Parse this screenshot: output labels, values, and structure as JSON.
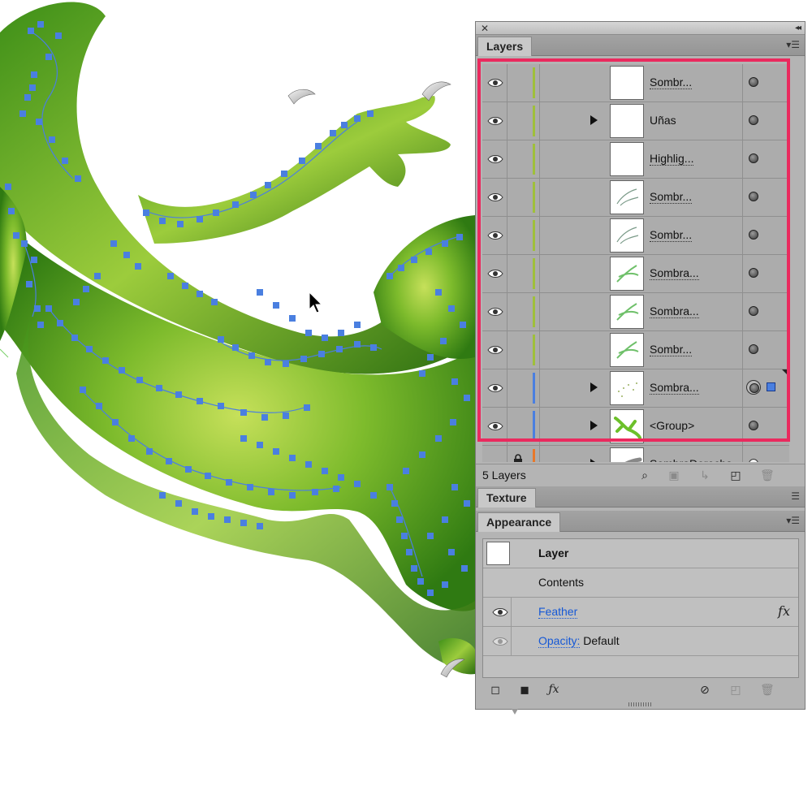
{
  "colors": {
    "highlight_border": "#ea2a5e",
    "layer_color_green": "#9fc03a",
    "layer_color_blue": "#4a7fe0",
    "layer_color_orange": "#e8782a",
    "path_anchor": "#4a7fe0",
    "link_text": "#1558d6"
  },
  "layers_panel": {
    "tab_label": "Layers",
    "menu_icon": "panel-menu-icon",
    "rows": [
      {
        "name": "Sombr...",
        "has_twisty": false,
        "thumb": "blank",
        "color": "green",
        "target": "filled"
      },
      {
        "name": "Uñas",
        "has_twisty": true,
        "thumb": "blank",
        "color": "green",
        "target": "filled"
      },
      {
        "name": "Highlig...",
        "has_twisty": false,
        "thumb": "blank",
        "color": "green",
        "target": "filled"
      },
      {
        "name": "Sombr...",
        "has_twisty": false,
        "thumb": "sketch",
        "color": "green",
        "target": "filled"
      },
      {
        "name": "Sombr...",
        "has_twisty": false,
        "thumb": "sketch",
        "color": "green",
        "target": "filled"
      },
      {
        "name": "Sombra...",
        "has_twisty": false,
        "thumb": "green",
        "color": "green",
        "target": "filled"
      },
      {
        "name": "Sombra...",
        "has_twisty": false,
        "thumb": "green",
        "color": "green",
        "target": "filled"
      },
      {
        "name": "Sombr...",
        "has_twisty": false,
        "thumb": "green",
        "color": "green",
        "target": "filled"
      },
      {
        "name": "Sombra...",
        "has_twisty": true,
        "thumb": "dots",
        "color": "blue",
        "target": "ring",
        "selected": true
      },
      {
        "name": "<Group>",
        "has_twisty": true,
        "thumb": "lizard",
        "color": "blue",
        "target": "filled"
      },
      {
        "name": "SombraDerecha",
        "has_twisty": true,
        "thumb": "gray",
        "color": "orange",
        "target": "hollow",
        "locked": true
      }
    ],
    "footer": {
      "count_label": "5 Layers"
    }
  },
  "texture_panel": {
    "tab_label": "Texture"
  },
  "appearance_panel": {
    "tab_label": "Appearance",
    "rows": {
      "layer_label": "Layer",
      "contents_label": "Contents",
      "feather_label": "Feather",
      "opacity_label": "Opacity:",
      "opacity_value": "Default",
      "fx_symbol": "fx"
    }
  }
}
